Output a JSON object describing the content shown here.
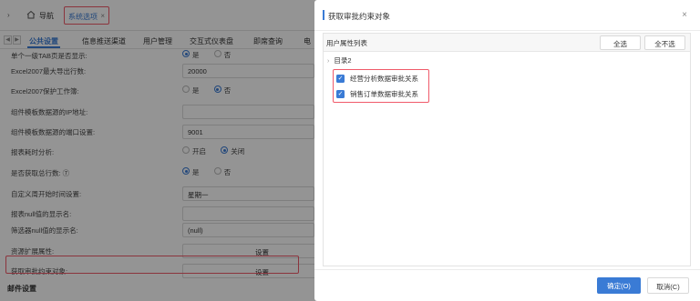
{
  "topbar": {
    "nav_label": "导航",
    "tab_label": "系统选项",
    "tab_close": "×"
  },
  "subtabs": [
    "公共设置",
    "信息推送渠道",
    "用户管理",
    "交互式仪表盘",
    "即席查询",
    "电"
  ],
  "settings": {
    "rows": [
      {
        "label": "单个一级TAB页是否显示:",
        "type": "radio",
        "options": [
          "是",
          "否"
        ],
        "selected": 0
      },
      {
        "label": "Excel2007最大导出行数:",
        "type": "input",
        "value": "20000"
      },
      {
        "label": "Excel2007保护工作簿:",
        "type": "radio",
        "options": [
          "是",
          "否"
        ],
        "selected": 1
      },
      {
        "label": "组件模板数据源的IP地址:",
        "type": "input",
        "value": ""
      },
      {
        "label": "组件模板数据源的端口设置:",
        "type": "input",
        "value": "9001"
      },
      {
        "label": "报表耗时分析:",
        "type": "radio",
        "options": [
          "开启",
          "关闭"
        ],
        "selected": 1
      },
      {
        "label": "是否获取总行数: ⑦",
        "type": "radio",
        "options": [
          "是",
          "否"
        ],
        "selected": 0
      },
      {
        "label": "自定义周开始时间设置:",
        "type": "input",
        "value": "星期一"
      },
      {
        "label": "报表null值的显示名:",
        "type": "input",
        "value": ""
      },
      {
        "label": "筛选器null值的显示名:",
        "type": "input",
        "value": "(null)"
      },
      {
        "label": "资源扩展属性:",
        "type": "button",
        "value": "设置"
      },
      {
        "label": "获取审批约束对象:",
        "type": "button",
        "value": "设置"
      }
    ],
    "section_title": "邮件设置"
  },
  "dialog": {
    "title": "获取审批约束对象",
    "close": "×",
    "panel_title": "用户属性列表",
    "select_all": "全选",
    "select_none": "全不选",
    "tree": {
      "root_caret": "›",
      "root_label": "目录2",
      "items": [
        {
          "label": "经营分析数据审批关系",
          "checked": true
        },
        {
          "label": "销售订单数据审批关系",
          "checked": true
        }
      ]
    },
    "ok": "确定(O)",
    "cancel": "取消(C)"
  },
  "colors": {
    "accent": "#3a7bd5",
    "highlight": "#f05a6a"
  }
}
